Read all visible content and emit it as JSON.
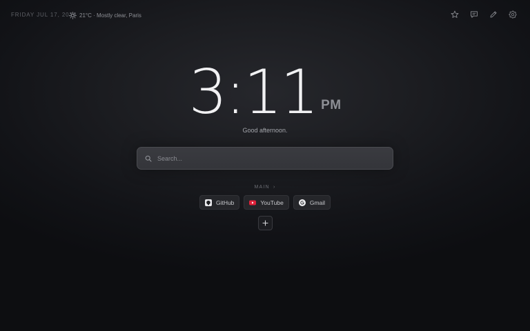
{
  "header": {
    "date": "FRIDAY JUL 17, 2026",
    "weather": {
      "icon": "sun-icon",
      "text": "21°C · Mostly clear, Paris"
    },
    "actions": [
      {
        "name": "favorites",
        "icon": "star-icon"
      },
      {
        "name": "notes",
        "icon": "chat-icon"
      },
      {
        "name": "edit",
        "icon": "pencil-icon"
      },
      {
        "name": "settings",
        "icon": "gear-icon"
      }
    ]
  },
  "clock": {
    "time": "3:11",
    "period": "PM"
  },
  "greeting": "Good afternoon.",
  "search": {
    "placeholder": "Search...",
    "value": ""
  },
  "group": {
    "label": "MAIN",
    "chevron": "›"
  },
  "shortcuts": [
    {
      "label": "GitHub",
      "icon": "github-icon"
    },
    {
      "label": "YouTube",
      "icon": "youtube-icon"
    },
    {
      "label": "Gmail",
      "icon": "google-icon"
    }
  ],
  "colors": {
    "accent": "#e6e6e9",
    "youtube": "#e0213a"
  }
}
